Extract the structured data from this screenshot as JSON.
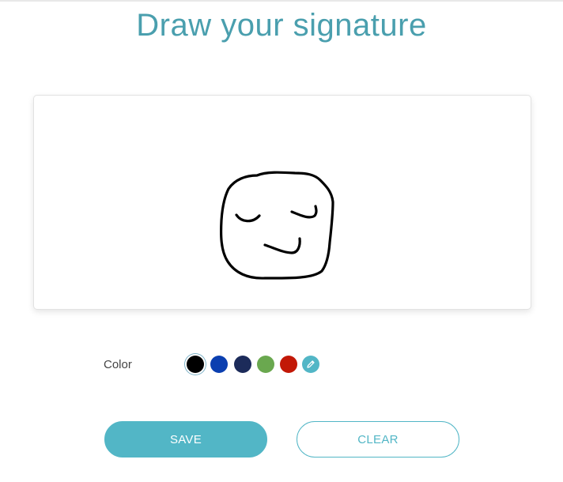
{
  "page": {
    "title": "Draw your signature"
  },
  "signature_pad": {
    "stroke_color": "#000000"
  },
  "color_picker": {
    "label": "Color",
    "selected": "black",
    "swatches": [
      {
        "name": "black",
        "hex": "#000000"
      },
      {
        "name": "blue",
        "hex": "#0b3fb0"
      },
      {
        "name": "navy",
        "hex": "#1c2b5a"
      },
      {
        "name": "green",
        "hex": "#6aa84f"
      },
      {
        "name": "red",
        "hex": "#c21807"
      },
      {
        "name": "custom-pen",
        "hex": "#52b6c6",
        "icon": "pencil-icon"
      }
    ]
  },
  "actions": {
    "save_label": "SAVE",
    "clear_label": "CLEAR"
  },
  "theme": {
    "accent": "#52b6c6",
    "title_color": "#4a9fae"
  }
}
